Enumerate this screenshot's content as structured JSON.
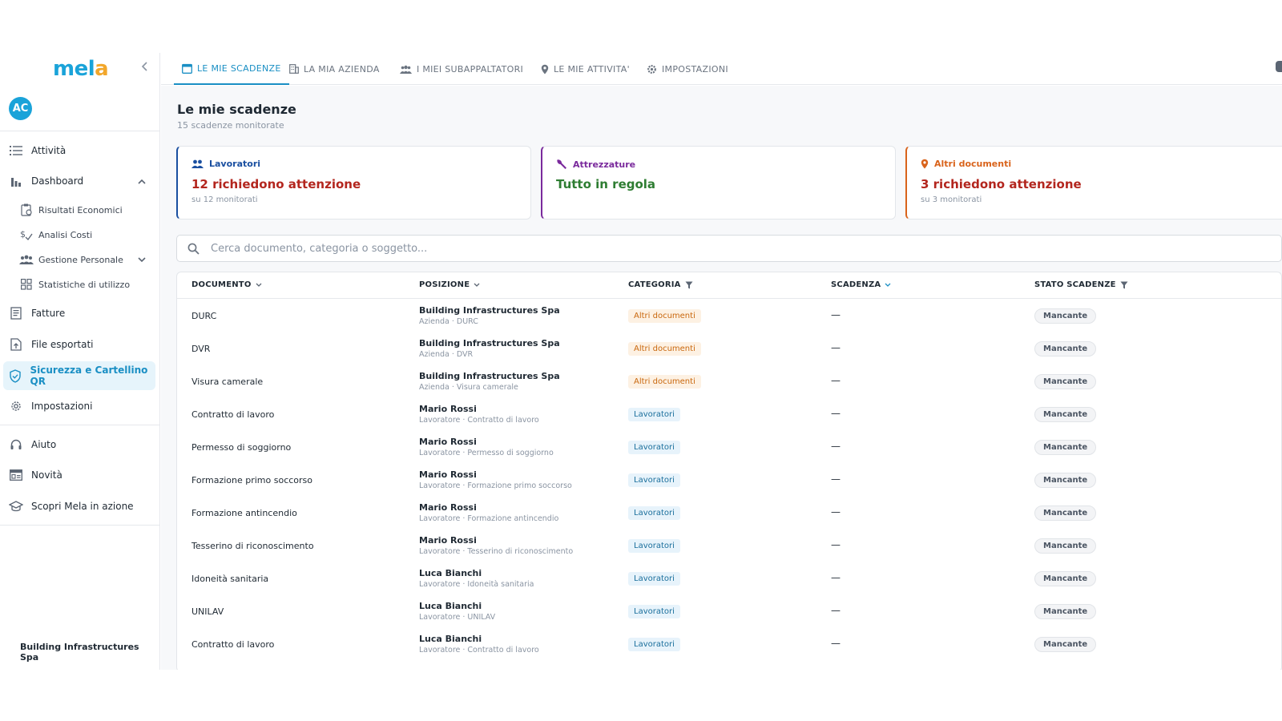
{
  "brand": {
    "logo_text_a": "mel",
    "logo_text_b": "a"
  },
  "user": {
    "initials": "AC"
  },
  "sidebar": {
    "items": [
      {
        "label": "Attività",
        "icon": "list-icon"
      },
      {
        "label": "Dashboard",
        "icon": "bar-chart-icon"
      },
      {
        "label": "Risultati Economici",
        "icon": "clipboard-chart-icon"
      },
      {
        "label": "Analisi Costi",
        "icon": "cost-icon"
      },
      {
        "label": "Gestione Personale",
        "icon": "people-icon"
      },
      {
        "label": "Statistiche di utilizzo",
        "icon": "grid-icon"
      },
      {
        "label": "Fatture",
        "icon": "invoice-icon"
      },
      {
        "label": "File esportati",
        "icon": "file-export-icon"
      },
      {
        "label": "Sicurezza e Cartellino QR",
        "icon": "shield-icon"
      },
      {
        "label": "Impostazioni",
        "icon": "gear-icon"
      },
      {
        "label": "Aiuto",
        "icon": "headset-icon"
      },
      {
        "label": "Novità",
        "icon": "news-icon"
      },
      {
        "label": "Scopri Mela in azione",
        "icon": "graduation-cap-icon"
      }
    ],
    "company": "Building Infrastructures Spa"
  },
  "tabs": [
    {
      "label": "LE MIE SCADENZE",
      "icon": "calendar-icon"
    },
    {
      "label": "LA MIA AZIENDA",
      "icon": "building-icon"
    },
    {
      "label": "I MIEI SUBAPPALTATORI",
      "icon": "group-icon"
    },
    {
      "label": "LE MIE ATTIVITA'",
      "icon": "pin-icon"
    },
    {
      "label": "IMPOSTAZIONI",
      "icon": "gear-icon"
    }
  ],
  "page": {
    "title": "Le mie scadenze",
    "subtitle": "15 scadenze monitorate"
  },
  "cards": [
    {
      "title": "Lavoratori",
      "value": "12 richiedono attenzione",
      "note": "su 12 monitorati",
      "accent": "#1a4fa0",
      "value_color": "#b3261e"
    },
    {
      "title": "Attrezzature",
      "value": "Tutto in regola",
      "note": "",
      "accent": "#7a2a9c",
      "value_color": "#2e7d32"
    },
    {
      "title": "Altri documenti",
      "value": "3 richiedono attenzione",
      "note": "su 3 monitorati",
      "accent": "#d9631b",
      "value_color": "#b3261e"
    }
  ],
  "search": {
    "placeholder": "Cerca documento, categoria o soggetto..."
  },
  "table": {
    "headers": [
      "DOCUMENTO",
      "POSIZIONE",
      "CATEGORIA",
      "SCADENZA",
      "STATO SCADENZE"
    ],
    "rows": [
      {
        "doc": "DURC",
        "pos": "Building Infrastructures Spa",
        "pos_sub": "Azienda · DURC",
        "cat": "Altri documenti",
        "exp": "—",
        "status": "Mancante"
      },
      {
        "doc": "DVR",
        "pos": "Building Infrastructures Spa",
        "pos_sub": "Azienda · DVR",
        "cat": "Altri documenti",
        "exp": "—",
        "status": "Mancante"
      },
      {
        "doc": "Visura camerale",
        "pos": "Building Infrastructures Spa",
        "pos_sub": "Azienda · Visura camerale",
        "cat": "Altri documenti",
        "exp": "—",
        "status": "Mancante"
      },
      {
        "doc": "Contratto di lavoro",
        "pos": "Mario Rossi",
        "pos_sub": "Lavoratore · Contratto di lavoro",
        "cat": "Lavoratori",
        "exp": "—",
        "status": "Mancante"
      },
      {
        "doc": "Permesso di soggiorno",
        "pos": "Mario Rossi",
        "pos_sub": "Lavoratore · Permesso di soggiorno",
        "cat": "Lavoratori",
        "exp": "—",
        "status": "Mancante"
      },
      {
        "doc": "Formazione primo soccorso",
        "pos": "Mario Rossi",
        "pos_sub": "Lavoratore · Formazione primo soccorso",
        "cat": "Lavoratori",
        "exp": "—",
        "status": "Mancante"
      },
      {
        "doc": "Formazione antincendio",
        "pos": "Mario Rossi",
        "pos_sub": "Lavoratore · Formazione antincendio",
        "cat": "Lavoratori",
        "exp": "—",
        "status": "Mancante"
      },
      {
        "doc": "Tesserino di riconoscimento",
        "pos": "Mario Rossi",
        "pos_sub": "Lavoratore · Tesserino di riconoscimento",
        "cat": "Lavoratori",
        "exp": "—",
        "status": "Mancante"
      },
      {
        "doc": "Idoneità sanitaria",
        "pos": "Luca Bianchi",
        "pos_sub": "Lavoratore · Idoneità sanitaria",
        "cat": "Lavoratori",
        "exp": "—",
        "status": "Mancante"
      },
      {
        "doc": "UNILAV",
        "pos": "Luca Bianchi",
        "pos_sub": "Lavoratore · UNILAV",
        "cat": "Lavoratori",
        "exp": "—",
        "status": "Mancante"
      },
      {
        "doc": "Contratto di lavoro",
        "pos": "Luca Bianchi",
        "pos_sub": "Lavoratore · Contratto di lavoro",
        "cat": "Lavoratori",
        "exp": "—",
        "status": "Mancante"
      }
    ]
  }
}
